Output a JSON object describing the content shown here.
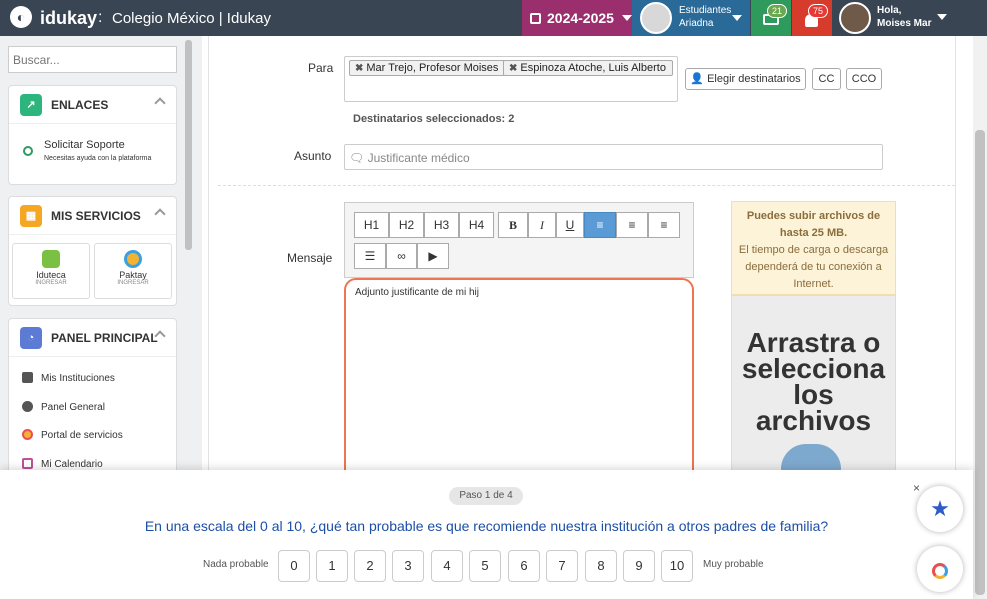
{
  "header": {
    "brand": "idukay",
    "separator": ":",
    "school": "Colegio México | Idukay",
    "year": "2024-2025",
    "students_label": "Estudiantes",
    "student_name": "Ariadna",
    "messages_count": "21",
    "notifications_count": "75",
    "greeting": "Hola,",
    "user_name": "Moises Mar"
  },
  "sidebar": {
    "search_placeholder": "Buscar...",
    "enlaces": {
      "title": "ENLACES",
      "item_title": "Solicitar Soporte",
      "item_sub": "Necesitas ayuda con la plataforma"
    },
    "servicios": {
      "title": "MIS SERVICIOS",
      "tiles": [
        {
          "name": "Iduteca",
          "sub": "INGRESAR"
        },
        {
          "name": "Paktay",
          "sub": "INGRESAR"
        }
      ]
    },
    "panel": {
      "title": "PANEL PRINCIPAL",
      "items": [
        "Mis Instituciones",
        "Panel General",
        "Portal de servicios",
        "Mi Calendario"
      ]
    }
  },
  "form": {
    "para_label": "Para",
    "recipients": [
      "Mar Trejo, Profesor Moises",
      "Espinoza Atoche, Luis Alberto"
    ],
    "choose_recipients": "Elegir destinatarios",
    "cc": "CC",
    "cco": "CCO",
    "selected_count": "Destinatarios seleccionados: 2",
    "asunto_label": "Asunto",
    "asunto_value": "Justificante médico",
    "mensaje_label": "Mensaje",
    "toolbar": {
      "h1": "H1",
      "h2": "H2",
      "h3": "H3",
      "h4": "H4",
      "bold": "B",
      "italic": "I",
      "underline": "U"
    },
    "message_text": "Adjunto justificante de mi hij"
  },
  "upload": {
    "info_title": "Puedes subir archivos de hasta 25 MB.",
    "info_text": "El tiempo de carga o descarga dependerá de tu conexión a Internet.",
    "drop_text": "Arrastra o selecciona los archivos"
  },
  "survey": {
    "step": "Paso 1 de 4",
    "question": "En una escala del 0 al 10, ¿qué tan probable es que recomiende nuestra institución a otros padres de familia?",
    "low_label": "Nada probable",
    "high_label": "Muy probable",
    "options": [
      "0",
      "1",
      "2",
      "3",
      "4",
      "5",
      "6",
      "7",
      "8",
      "9",
      "10"
    ],
    "close": "×"
  },
  "colors": {
    "topbar": "#394553",
    "year": "#9b2f6d",
    "students": "#2a6a99",
    "messages": "#2e9b5d",
    "notifications": "#d63b2b",
    "highlight_border": "#ef7550",
    "question": "#1d4fa6"
  }
}
